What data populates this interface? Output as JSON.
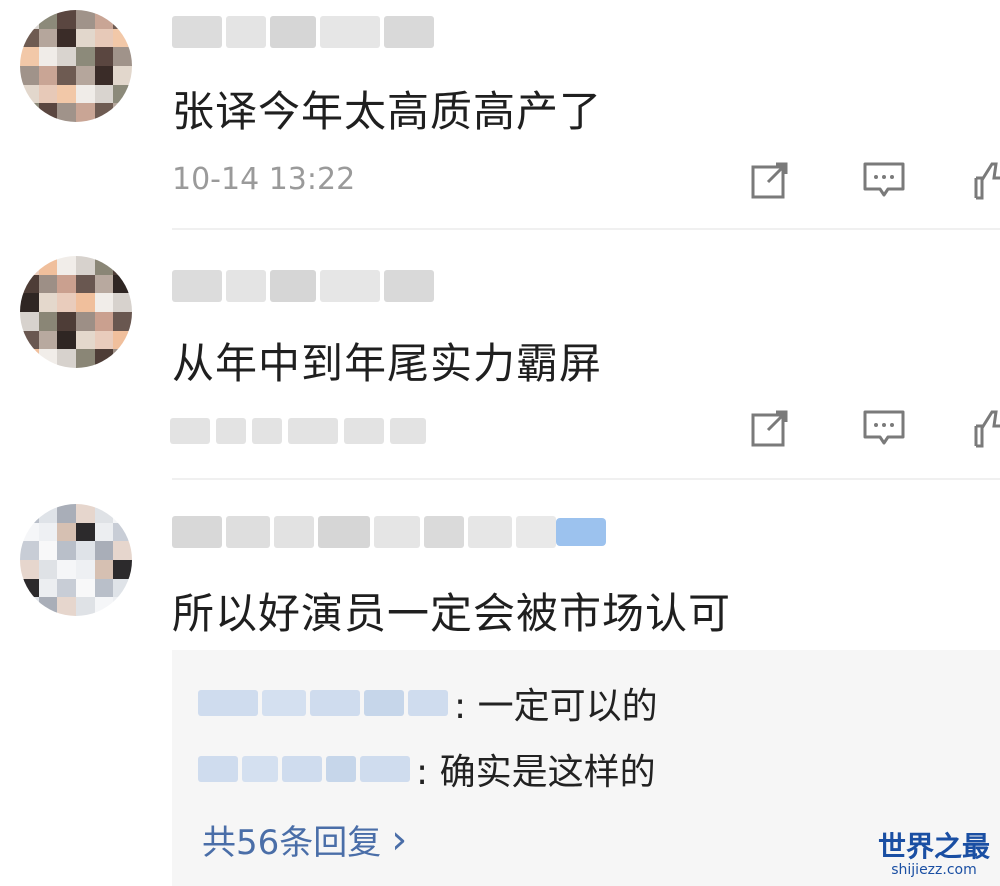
{
  "comments": [
    {
      "text": "张译今年太高质高产了",
      "time": "10-14 13:22",
      "actions": [
        "share-icon",
        "comment-icon",
        "like-icon"
      ]
    },
    {
      "text": "从年中到年尾实力霸屏",
      "actions": [
        "share-icon",
        "comment-icon",
        "like-icon"
      ]
    },
    {
      "text": "所以好演员一定会被市场认可",
      "replies": [
        {
          "text": ": 一定可以的"
        },
        {
          "text": ": 确实是这样的"
        }
      ],
      "more_replies": "共56条回复",
      "more_chevron": "›"
    }
  ],
  "watermark": {
    "title": "世界之最",
    "url": "shijiezz.com"
  },
  "colors": {
    "link": "#4a6ea8",
    "reply_bg": "#f6f6f6",
    "time": "#9a9a9a"
  }
}
